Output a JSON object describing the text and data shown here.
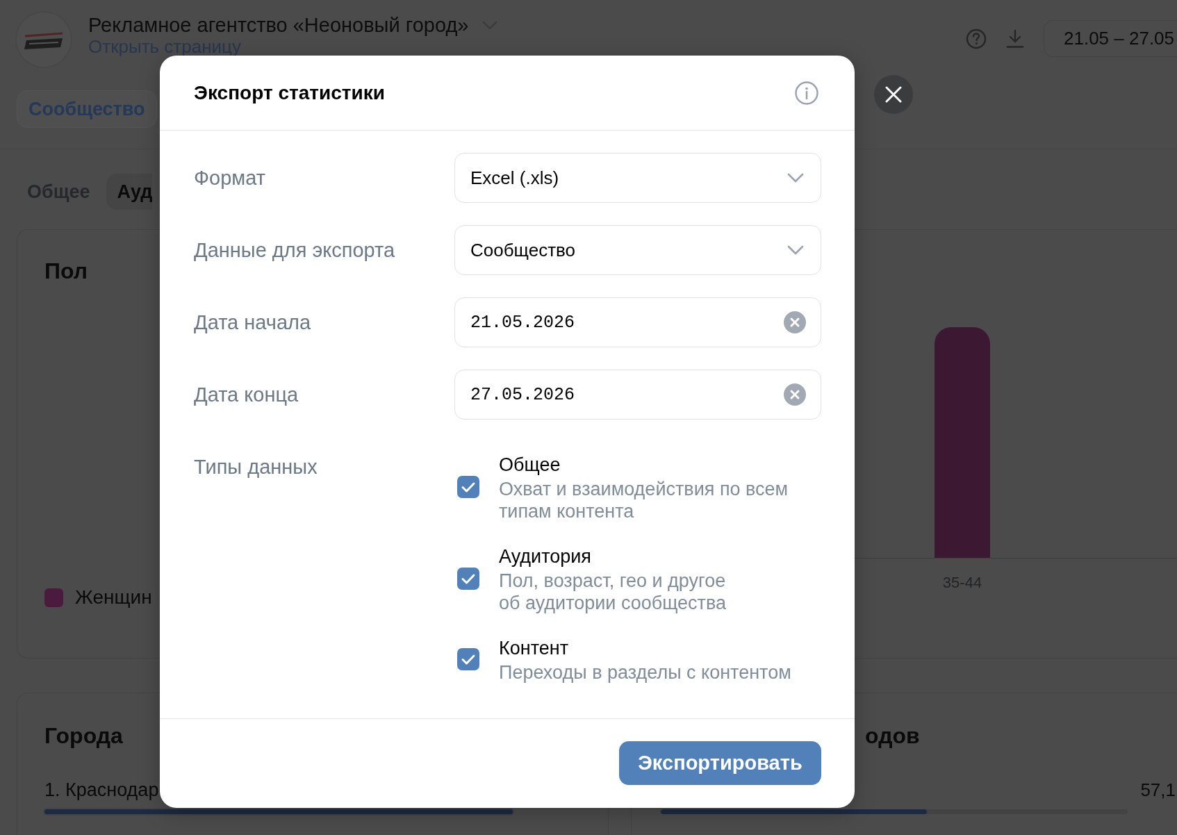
{
  "header": {
    "community_name": "Рекламное агентство «Неоновый город»",
    "open_link": "Открыть страницу",
    "date_range": "21.05 – 27.05"
  },
  "nav_tabs": [
    {
      "label": "Сообщество",
      "selected": true
    }
  ],
  "section_tabs": [
    {
      "label": "Общее",
      "selected": false
    },
    {
      "label": "Ауд",
      "selected": true
    }
  ],
  "gender_card": {
    "title": "Пол",
    "legend": [
      {
        "label": "Женщин",
        "color": "#4a1a3f"
      }
    ],
    "bar_label": "35-44"
  },
  "cities_card": {
    "title": "Города",
    "rows": [
      {
        "label": "1. Краснодар",
        "level": 1
      }
    ]
  },
  "sources_card": {
    "title": "одов",
    "rows": [
      {
        "value": "57,1",
        "level": 0.57
      }
    ]
  },
  "dialog": {
    "title": "Экспорт статистики",
    "fields": [
      {
        "label": "Формат",
        "kind": "select",
        "value": "Excel (.xls)"
      },
      {
        "label": "Данные для экспорта",
        "kind": "select",
        "value": "Сообщество"
      },
      {
        "label": "Дата начала",
        "kind": "date",
        "value": "21.05.2026"
      },
      {
        "label": "Дата конца",
        "kind": "date",
        "value": "27.05.2026"
      }
    ],
    "types_label": "Типы данных",
    "types": [
      {
        "title": "Общее",
        "description": "Охват и взаимодействия по всем\nтипам контента",
        "checked": true
      },
      {
        "title": "Аудитория",
        "description": "Пол, возраст, гео и другое\nоб аудитории сообщества",
        "checked": true
      },
      {
        "title": "Контент",
        "description": "Переходы в разделы с контентом",
        "checked": true
      }
    ],
    "submit": "Экспортировать"
  }
}
